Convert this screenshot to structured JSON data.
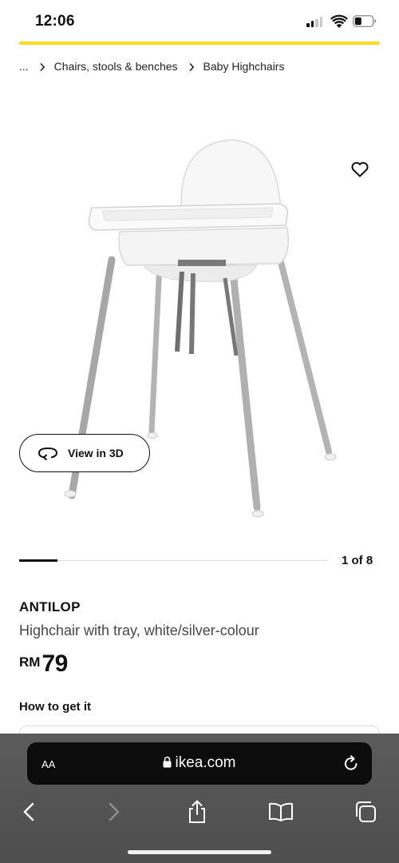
{
  "status_bar": {
    "time": "12:06"
  },
  "page_load": {
    "progress": 1.0,
    "color": "#ffda1a"
  },
  "breadcrumb": {
    "ellipsis": "...",
    "items": [
      "Chairs, stools & benches",
      "Baby Highchairs"
    ]
  },
  "product_image": {
    "favourite_icon": "heart-outline-icon",
    "view3d_label": "View in 3D",
    "view3d_icon": "rotate-3d-icon"
  },
  "carousel": {
    "current": 1,
    "total": 8,
    "counter_text": "1 of 8"
  },
  "product": {
    "name": "ANTILOP",
    "description": "Highchair with tray, white/silver-colour",
    "currency": "RM",
    "price": "79"
  },
  "fulfilment": {
    "heading": "How to get it"
  },
  "browser": {
    "text_size_label": "AA",
    "url": "ikea.com",
    "icons": [
      "back-icon",
      "forward-icon",
      "share-icon",
      "bookmarks-icon",
      "tabs-icon"
    ]
  }
}
